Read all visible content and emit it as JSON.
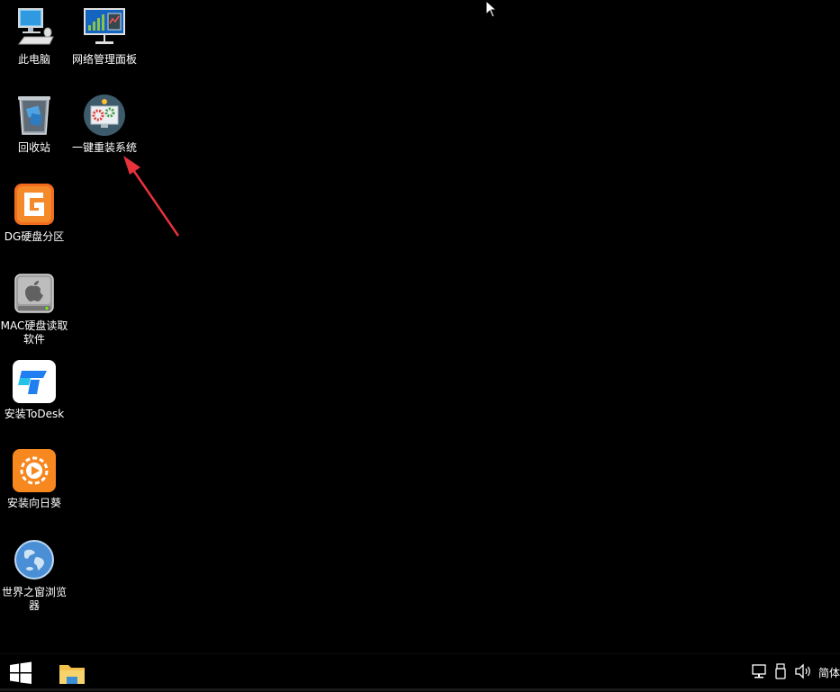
{
  "desktop": {
    "icons": [
      {
        "label": "此电脑",
        "icon": "computer-icon"
      },
      {
        "label": "网络管理面板",
        "icon": "network-panel-icon"
      },
      {
        "label": "回收站",
        "icon": "recycle-bin-icon"
      },
      {
        "label": "一键重装系统",
        "icon": "reinstall-system-icon"
      },
      {
        "label": "DG硬盘分区",
        "icon": "diskgenius-icon"
      },
      {
        "label": "MAC硬盘读取软件",
        "icon": "mac-disk-icon"
      },
      {
        "label": "安装ToDesk",
        "icon": "todesk-icon"
      },
      {
        "label": "安装向日葵",
        "icon": "sunflower-icon"
      },
      {
        "label": "世界之窗浏览器",
        "icon": "globe-browser-icon"
      }
    ]
  },
  "taskbar": {
    "ime_label": "简体",
    "tray_icons": [
      "network-tray-icon",
      "usb-tray-icon",
      "volume-tray-icon"
    ]
  },
  "colors": {
    "background": "#000000",
    "annotation_arrow": "#e8323a",
    "windows_logo": "#ffffff",
    "folder": "#f2c14e"
  }
}
